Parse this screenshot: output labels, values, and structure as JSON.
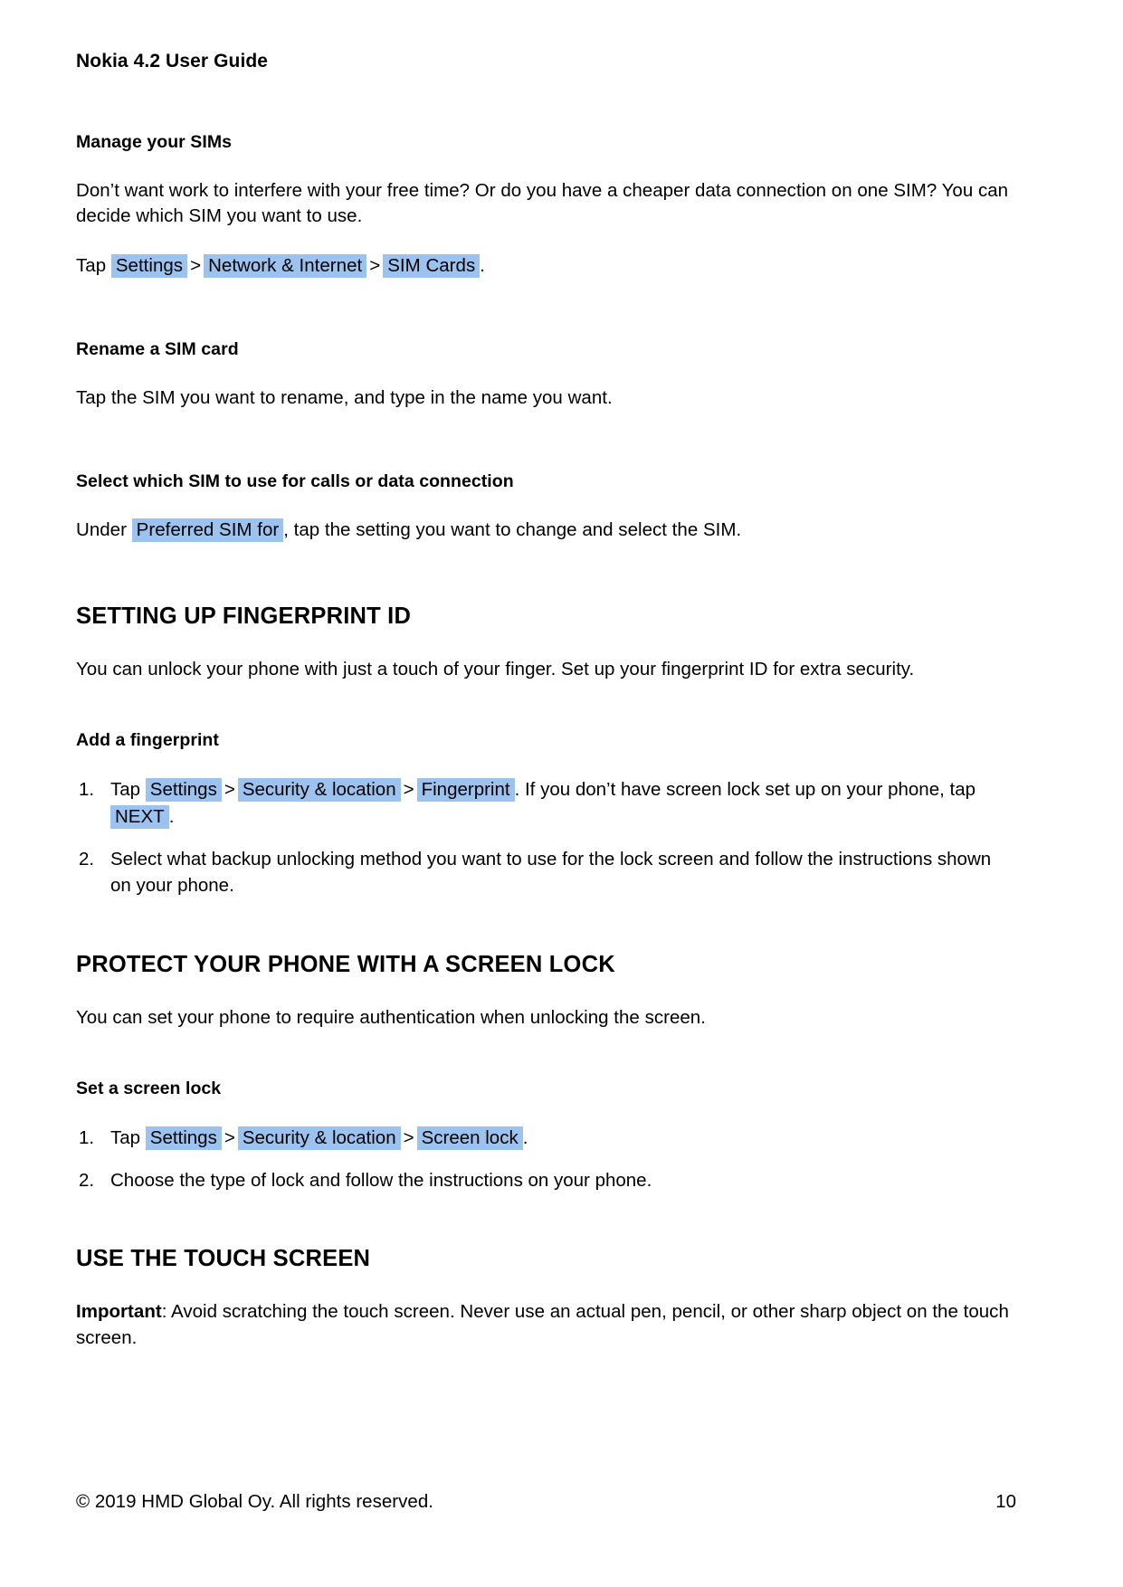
{
  "document": {
    "running_head": "Nokia 4.2 User Guide",
    "footer": {
      "copyright": "© 2019 HMD Global Oy. All rights reserved.",
      "page_number": "10"
    },
    "highlight_color": "#9cc3f0"
  },
  "sections": {
    "manage_sims": {
      "heading": "Manage your SIMs",
      "paragraph": "Don’t want work to interfere with your free time? Or do you have a cheaper data connection on one SIM? You can decide which SIM you want to use.",
      "path_prefix": "Tap",
      "path_items": [
        "Settings",
        "Network & Internet",
        "SIM Cards"
      ],
      "separator": ">",
      "path_suffix": "."
    },
    "rename_sim": {
      "heading": "Rename a SIM card",
      "paragraph": "Tap the SIM you want to rename, and type in the name you want."
    },
    "select_sim": {
      "heading": "Select which SIM to use for calls or data connection",
      "text_before": "Under",
      "highlight": "Preferred SIM for",
      "text_after": ", tap the setting you want to change and select the SIM."
    },
    "fingerprint": {
      "heading": "SETTING UP FINGERPRINT ID",
      "paragraph": "You can unlock your phone with just a touch of your finger. Set up your fingerprint ID for extra security.",
      "sub_heading": "Add a fingerprint",
      "step1": {
        "prefix": "Tap",
        "items": [
          "Settings",
          "Security & location",
          "Fingerprint"
        ],
        "separator": ">",
        "middle": ". If you don’t have screen lock set up on your phone, tap",
        "last_highlight": "NEXT",
        "suffix": "."
      },
      "step2": "Select what backup unlocking method you want to use for the lock screen and follow the instructions shown on your phone."
    },
    "screen_lock": {
      "heading": "PROTECT YOUR PHONE WITH A SCREEN LOCK",
      "paragraph": "You can set your phone to require authentication when unlocking the screen.",
      "sub_heading": "Set a screen lock",
      "step1": {
        "prefix": "Tap",
        "items": [
          "Settings",
          "Security & location",
          "Screen lock"
        ],
        "separator": ">",
        "suffix": "."
      },
      "step2": "Choose the type of lock and follow the instructions on your phone."
    },
    "touch_screen": {
      "heading": "USE THE TOUCH SCREEN",
      "important_label": "Important",
      "important_text": ": Avoid scratching the touch screen. Never use an actual pen, pencil, or other sharp object on the touch screen."
    }
  }
}
